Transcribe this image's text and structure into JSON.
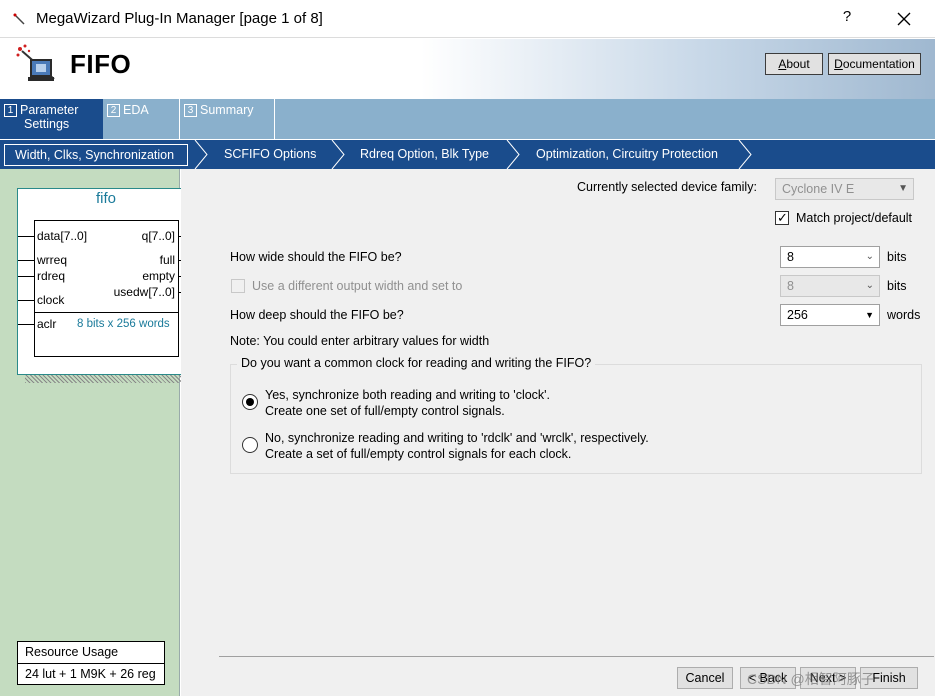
{
  "window": {
    "title": "MegaWizard Plug-In Manager [page 1 of 8]",
    "help": "?",
    "close_icon": "close-icon"
  },
  "header": {
    "heading": "FIFO",
    "about_label": "About",
    "about_underline": "A",
    "about_rest": "bout",
    "docs_label": "Documentation",
    "docs_underline": "D",
    "docs_rest": "ocumentation"
  },
  "steps": [
    {
      "num": "1",
      "line1": "Parameter",
      "line2": "Settings",
      "active": true
    },
    {
      "num": "2",
      "line1": "EDA",
      "active": false
    },
    {
      "num": "3",
      "line1": "Summary",
      "active": false
    }
  ],
  "subtabs": [
    {
      "label": "Width, Clks, Synchronization",
      "active": true
    },
    {
      "label": "SCFIFO Options"
    },
    {
      "label": "Rdreq Option, Blk Type"
    },
    {
      "label": "Optimization, Circuitry Protection"
    }
  ],
  "symbol": {
    "name": "fifo",
    "inputs": [
      "data[7..0]",
      "wrreq",
      "rdreq",
      "clock",
      "aclr"
    ],
    "outputs": [
      "q[7..0]",
      "full",
      "empty",
      "usedw[7..0]"
    ],
    "info": "8 bits x 256 words"
  },
  "resource": {
    "title": "Resource Usage",
    "value": "24 lut + 1 M9K + 26 reg"
  },
  "form": {
    "device_family_label": "Currently selected device family:",
    "device_family_value": "Cyclone IV E",
    "match_label": "Match project/default",
    "width_label": "How wide should the FIFO be?",
    "width_value": "8",
    "width_unit": "bits",
    "diff_width_label": "Use a different output width and set to",
    "diff_width_value": "8",
    "diff_width_unit": "bits",
    "depth_label": "How deep should the FIFO be?",
    "depth_value": "256",
    "depth_unit": "words",
    "note": "Note: You could enter arbitrary values for width",
    "clock_group_label": "Do you want a common clock for reading and writing the FIFO?",
    "opt1_line1": "Yes, synchronize both reading and writing to 'clock'.",
    "opt1_line2": "Create one set of full/empty control signals.",
    "opt2_line1": "No, synchronize reading and writing to 'rdclk' and 'wrclk', respectively.",
    "opt2_line2": "Create a set of full/empty control signals for each clock."
  },
  "footer": {
    "cancel": "Cancel",
    "back": "< Back",
    "next": "Next >",
    "finish": "Finish",
    "watermark": "CSDN @相智阿豚子"
  },
  "colors": {
    "dark_blue": "#1a4c8c",
    "light_blue": "#8ab0cc",
    "green_panel": "#c4dcc0",
    "teal": "#1a7a9a"
  }
}
